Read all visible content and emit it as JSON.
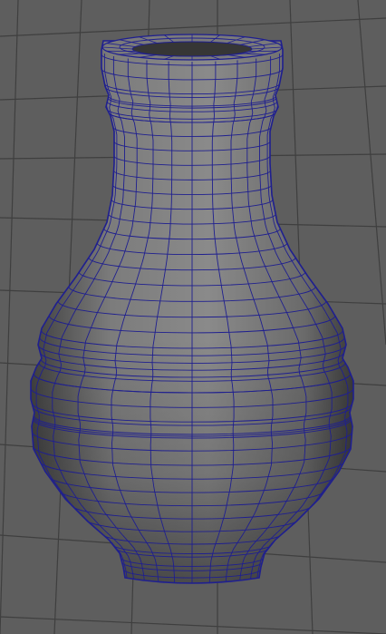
{
  "viewport": {
    "background": "#5e5e5e",
    "grid_color": "#3f3f3f",
    "grid_visible": true,
    "selection_wire_color": "#1f1f8f"
  },
  "object": {
    "kind": "vase",
    "display_mode": "smooth-shaded-with-wireframe",
    "selected": true,
    "shade_light": "#a6a6a6",
    "shade_dark": "#3c3c3c",
    "shade_mid": "#7a7a7a",
    "inner_rim_color": "#363636"
  }
}
